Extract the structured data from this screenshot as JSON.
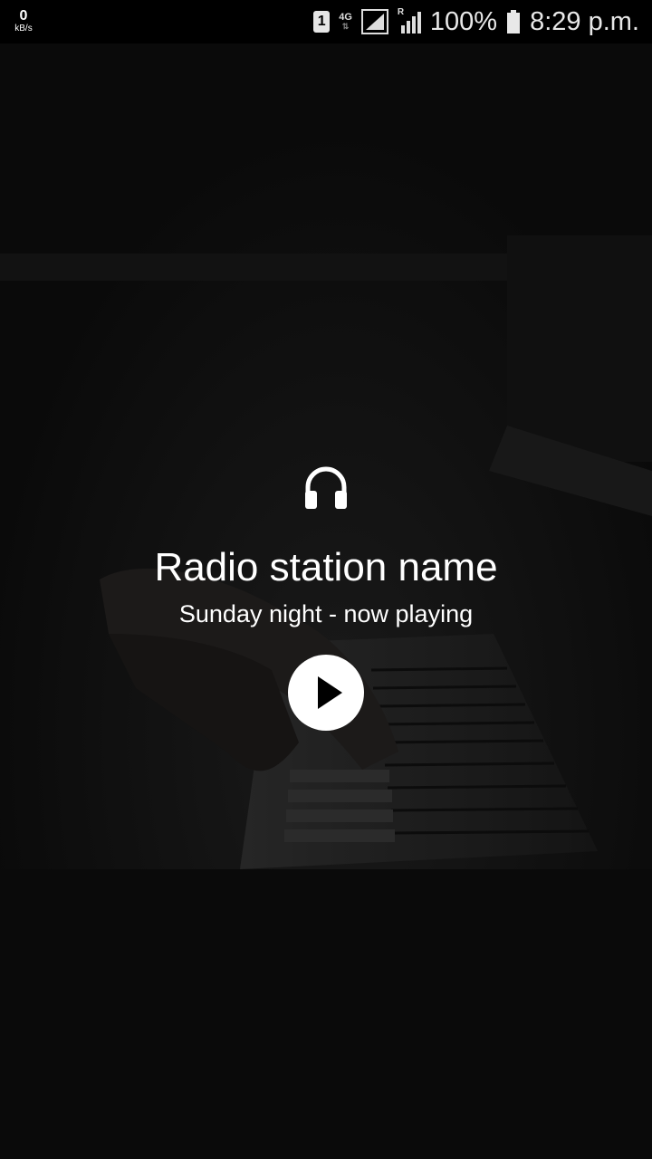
{
  "status_bar": {
    "net_speed_value": "0",
    "net_speed_unit": "kB/s",
    "sim_slot": "1",
    "network_type": "4G",
    "roaming_indicator": "R",
    "battery_percent": "100%",
    "time": "8:29 p.m."
  },
  "player": {
    "icon": "headphones-icon",
    "station_name": "Radio station name",
    "subtitle": "Sunday night - now playing",
    "play_icon": "play-icon"
  },
  "colors": {
    "background": "#0b0b0b",
    "text": "#ffffff",
    "play_button_bg": "#ffffff",
    "play_glyph": "#000000"
  }
}
